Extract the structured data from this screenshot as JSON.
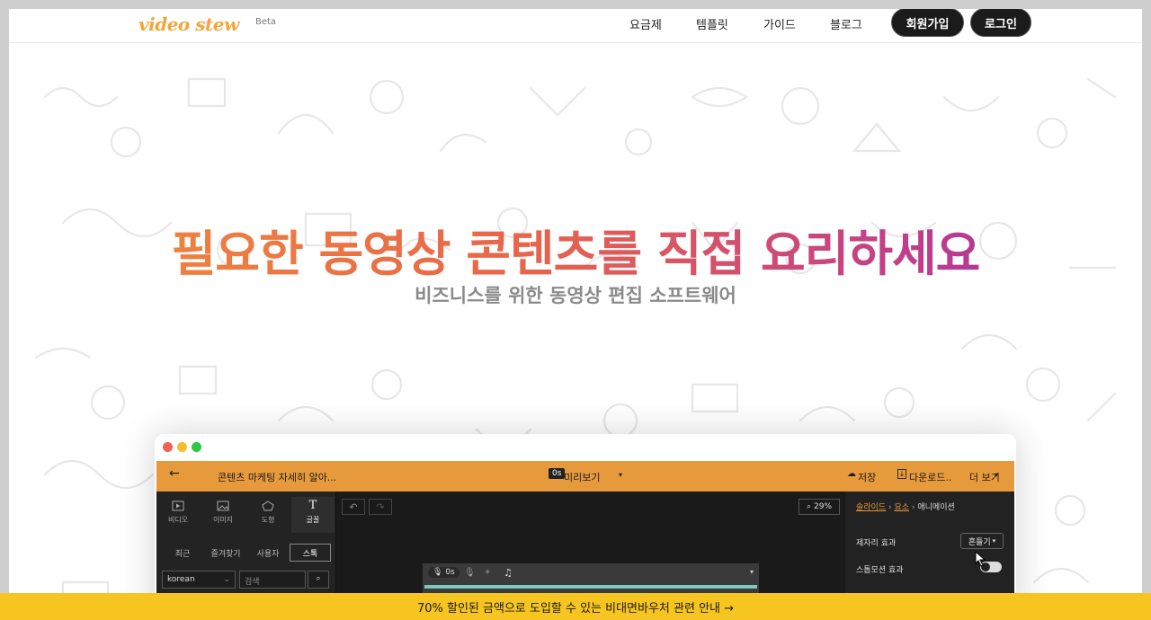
{
  "header": {
    "logo": "video stew",
    "beta": "Beta",
    "nav": [
      "요금제",
      "템플릿",
      "가이드",
      "블로그"
    ],
    "signup_label": "회원가입",
    "login_label": "로그인"
  },
  "hero": {
    "title": "필요한 동영상 콘텐츠를 직접 요리하세요",
    "subtitle": "비즈니스를 위한 동영상 편집 소프트웨어"
  },
  "app": {
    "project_title": "콘텐츠 마케팅 자세히 알아...",
    "preview_time": "0s",
    "preview_label": "미리보기",
    "save_label": "저장",
    "download_label": "다운로드..",
    "more_label": "더 보기",
    "tools": [
      "비디오",
      "이미지",
      "도형",
      "글꼴"
    ],
    "subtabs": [
      "최근",
      "즐겨찾기",
      "사용자",
      "스톡"
    ],
    "font_select": "korean",
    "search_placeholder": "검색",
    "zoom": "29%",
    "timeline_time": "0s",
    "breadcrumb": [
      "슬라이드",
      "요소",
      "애니메이션"
    ],
    "effect_label": "제자리 효과",
    "effect_value": "흔들기",
    "stopmotion_label": "스톱모션 효과"
  },
  "banner": {
    "text": "70% 할인된 금액으로 도입할 수 있는 비대면바우처 관련 안내 →"
  },
  "colors": {
    "accent": "#e79a3b",
    "banner": "#f6c51f",
    "gradient_start": "#f08f3c",
    "gradient_end": "#9a2ea1"
  }
}
